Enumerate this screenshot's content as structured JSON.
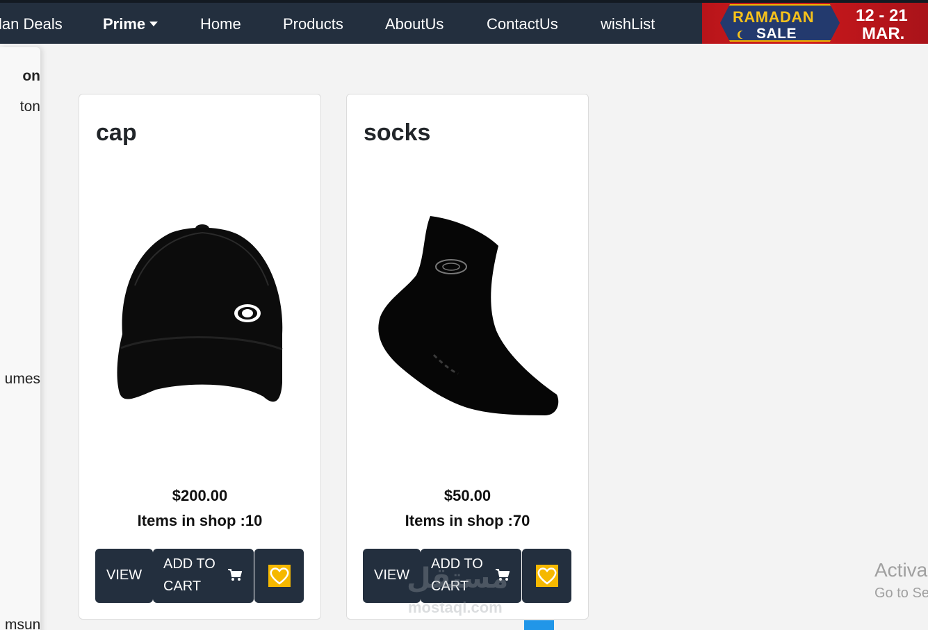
{
  "navbar": {
    "items": [
      {
        "label": "lan Deals"
      },
      {
        "label": "Prime"
      },
      {
        "label": "Home"
      },
      {
        "label": "Products"
      },
      {
        "label": "AboutUs"
      },
      {
        "label": "ContactUs"
      },
      {
        "label": "wishList"
      }
    ],
    "banner": {
      "line1": "RAMADAN",
      "line2": "SALE",
      "date_line1": "12 - 21",
      "date_line2": "MAR."
    }
  },
  "sidebar": {
    "items": [
      "on",
      "ton",
      "umes",
      "msung"
    ]
  },
  "products": [
    {
      "title": "cap",
      "price": "$200.00",
      "stock": "Items in shop :10",
      "view_label": "VIEW",
      "cart_line1": "ADD TO",
      "cart_line2": "CART",
      "image_icon": "cap-icon"
    },
    {
      "title": "socks",
      "price": "$50.00",
      "stock": "Items in shop :70",
      "view_label": "VIEW",
      "cart_line1": "ADD TO",
      "cart_line2": "CART",
      "image_icon": "sock-icon"
    }
  ],
  "windows_notice": {
    "line1": "Activa",
    "line2": "Go to Se"
  },
  "watermark": {
    "arabic": "مستقل",
    "latin": "mostaql.com"
  },
  "colors": {
    "navbar": "#232f3e",
    "button": "#232f3e",
    "heart": "#f5b800",
    "background": "#f3f3f3"
  }
}
